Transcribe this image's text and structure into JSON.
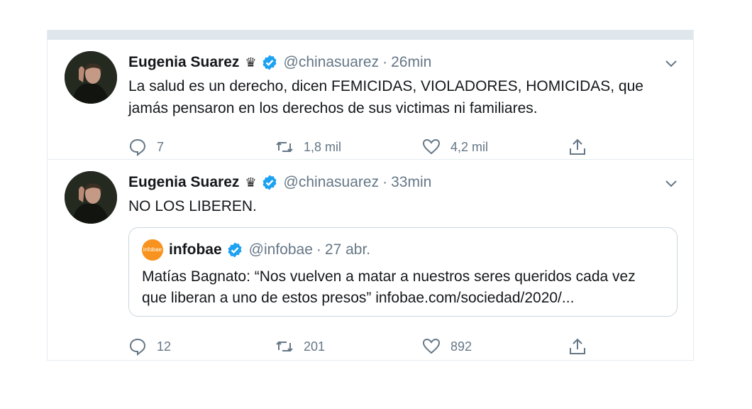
{
  "tweets": [
    {
      "author": "Eugenia Suarez",
      "crown": "♛",
      "handle": "@chinasuarez",
      "separator": "·",
      "time": "26min",
      "text_lines": [
        "La salud es un derecho, dicen FEMICIDAS, VIOLADORES, HOMICIDAS, que",
        "jamás pensaron en los derechos de sus victimas ni familiares."
      ],
      "replies": "7",
      "retweets": "1,8 mil",
      "likes": "4,2 mil"
    },
    {
      "author": "Eugenia Suarez",
      "crown": "♛",
      "handle": "@chinasuarez",
      "separator": "·",
      "time": "33min",
      "text_lines": [
        "NO LOS LIBEREN."
      ],
      "quote": {
        "logo_text": "infobae",
        "author": "infobae",
        "handle": "@infobae",
        "separator": "·",
        "time": "27 abr.",
        "text_lines": [
          "Matías Bagnato: “Nos vuelven a matar a nuestros seres queridos cada vez",
          "que liberan a uno de estos presos” infobae.com/sociedad/2020/..."
        ]
      },
      "replies": "12",
      "retweets": "201",
      "likes": "892"
    }
  ],
  "colors": {
    "verified": "#1da1f2",
    "muted": "#657786",
    "border": "#e6ecf0",
    "infobae": "#f7931e"
  },
  "icons": [
    "reply-icon",
    "retweet-icon",
    "like-icon",
    "share-icon",
    "verified-icon",
    "chevron-down-icon"
  ]
}
